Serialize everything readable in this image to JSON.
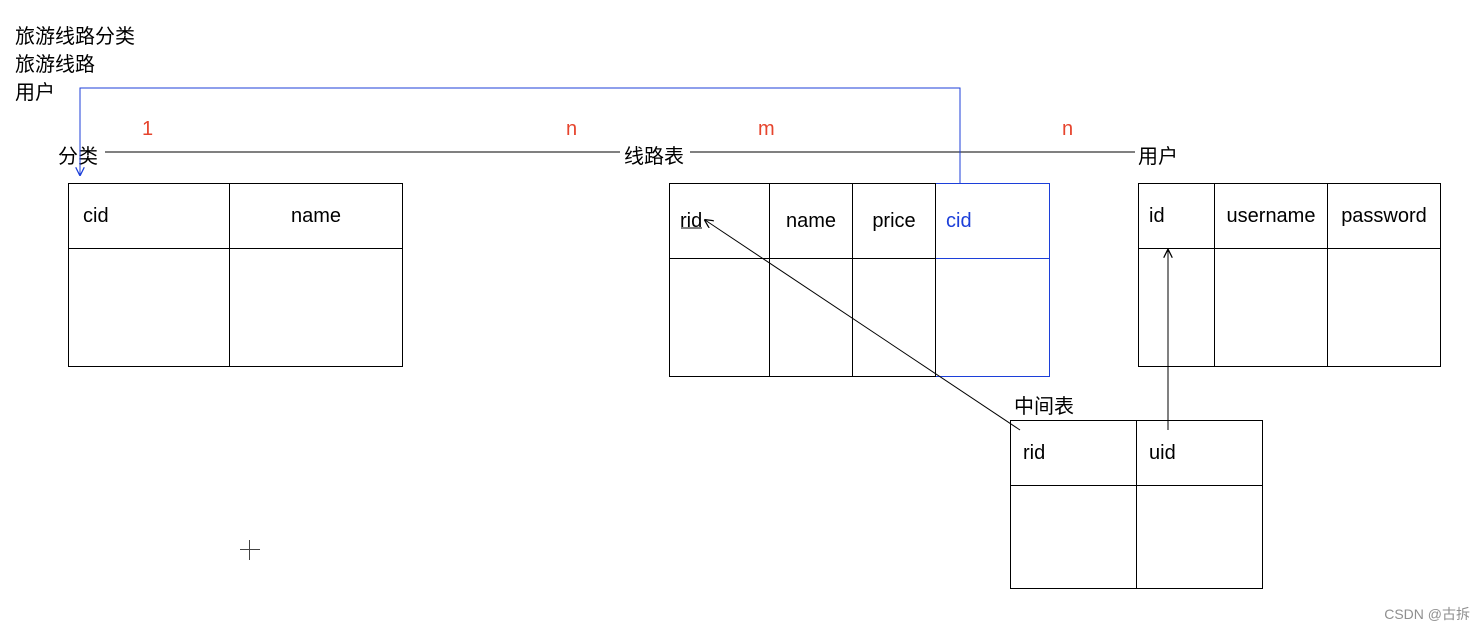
{
  "heading": {
    "line1": "旅游线路分类",
    "line2": "旅游线路",
    "line3": "用户"
  },
  "rel": {
    "left_card": "1",
    "mid_left_card": "n",
    "mid_right_card": "m",
    "right_card": "n"
  },
  "tables": {
    "category": {
      "title": "分类",
      "cols": {
        "cid": "cid",
        "name": "name"
      }
    },
    "route": {
      "title": "线路表",
      "cols": {
        "rid": "rid",
        "name": "name",
        "price": "price",
        "cid": "cid"
      }
    },
    "user": {
      "title": "用户",
      "cols": {
        "id": "id",
        "username": "username",
        "password": "password"
      }
    },
    "junction": {
      "title": "中间表",
      "cols": {
        "rid": "rid",
        "uid": "uid"
      }
    }
  },
  "watermark": "CSDN @古拆"
}
